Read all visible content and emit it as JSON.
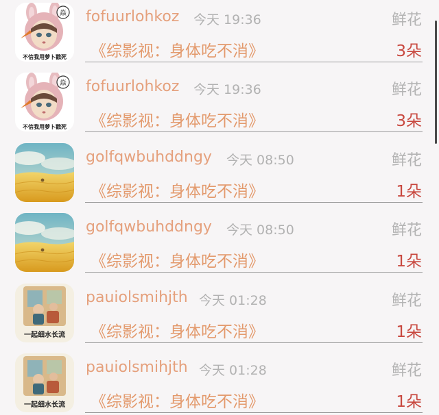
{
  "rows": [
    {
      "avatar": "rabbit-girl-avatar",
      "avatar_caption": "不信我用萝卜戳死",
      "username": "fofuurlohkoz",
      "time": "今天 19:36",
      "gift": "鲜花",
      "title": "《综影视：身体吃不消》",
      "quantity": "3朵"
    },
    {
      "avatar": "rabbit-girl-avatar",
      "avatar_caption": "不信我用萝卜戳死",
      "username": "fofuurlohkoz",
      "time": "今天 19:36",
      "gift": "鲜花",
      "title": "《综影视：身体吃不消》",
      "quantity": "3朵"
    },
    {
      "avatar": "wheat-field-avatar",
      "username": "golfqwbuhddngy",
      "time": "今天 08:50",
      "gift": "鲜花",
      "title": "《综影视：身体吃不消》",
      "quantity": "1朵"
    },
    {
      "avatar": "wheat-field-avatar",
      "username": "golfqwbuhddngy",
      "time": "今天 08:50",
      "gift": "鲜花",
      "title": "《综影视：身体吃不消》",
      "quantity": "1朵"
    },
    {
      "avatar": "painting-avatar",
      "avatar_caption": "一起细水长流",
      "username": "pauiolsmihjth",
      "time": "今天 01:28",
      "gift": "鲜花",
      "title": "《综影视：身体吃不消》",
      "quantity": "1朵"
    },
    {
      "avatar": "painting-avatar",
      "avatar_caption": "一起细水长流",
      "username": "pauiolsmihjth",
      "time": "今天 01:28",
      "gift": "鲜花",
      "title": "《综影视：身体吃不消》",
      "quantity": "1朵"
    }
  ],
  "colors": {
    "background": "#f7f5f6",
    "username": "#e5a07c",
    "title": "#e39a6d",
    "quantity": "#c8473e",
    "muted": "#b3b3b3"
  }
}
